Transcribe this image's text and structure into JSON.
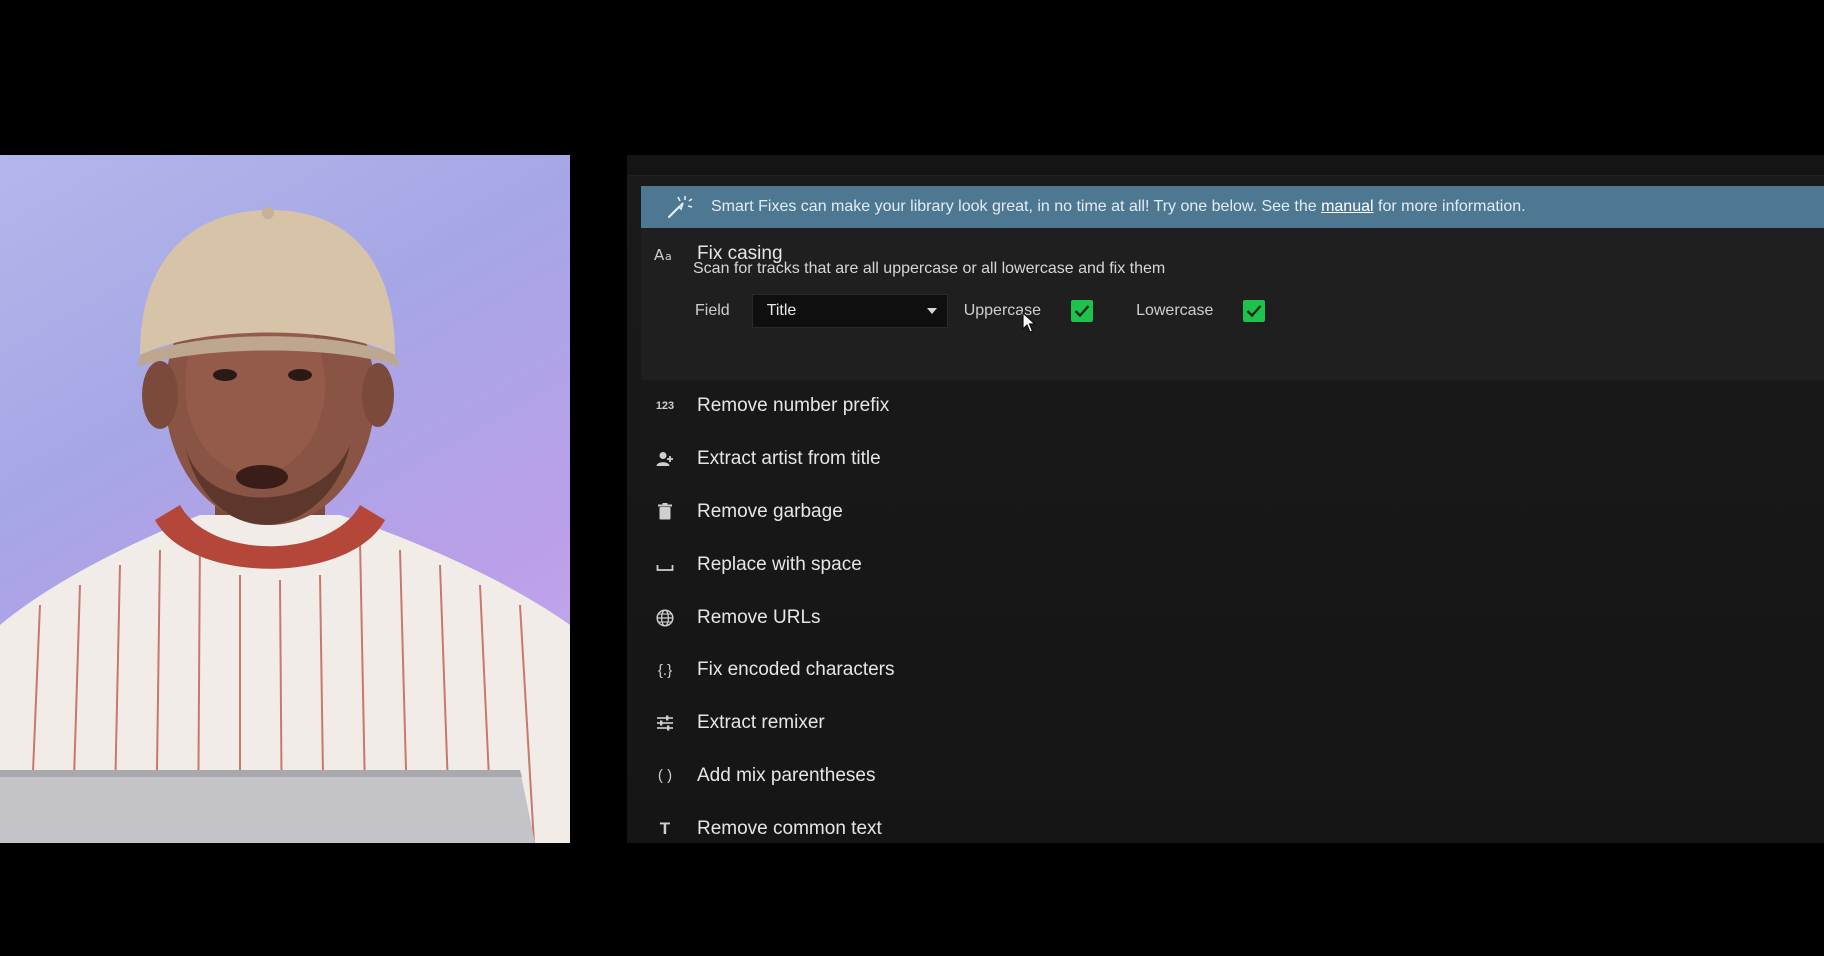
{
  "banner": {
    "text_before": "Smart Fixes can make your library look great, in no time at all! Try one below. See the ",
    "link_text": "manual",
    "text_after": " for more information."
  },
  "expanded_fix": {
    "title": "Fix casing",
    "icon": "text-case-icon",
    "description": "Scan for tracks that are all uppercase or all lowercase and fix them",
    "field_label": "Field",
    "field_value": "Title",
    "uppercase_label": "Uppercase",
    "uppercase_checked": true,
    "lowercase_label": "Lowercase",
    "lowercase_checked": true
  },
  "fixes": [
    {
      "icon": "number-123-icon",
      "glyph": "123",
      "title": "Remove number prefix"
    },
    {
      "icon": "person-add-icon",
      "glyph": "",
      "title": "Extract artist from title"
    },
    {
      "icon": "trash-icon",
      "glyph": "",
      "title": "Remove garbage"
    },
    {
      "icon": "space-bar-icon",
      "glyph": "",
      "title": "Replace with space"
    },
    {
      "icon": "globe-icon",
      "glyph": "",
      "title": "Remove URLs"
    },
    {
      "icon": "braces-icon",
      "glyph": "{.}",
      "title": "Fix encoded characters"
    },
    {
      "icon": "sliders-icon",
      "glyph": "",
      "title": "Extract remixer"
    },
    {
      "icon": "parentheses-icon",
      "glyph": "( )",
      "title": "Add mix parentheses"
    },
    {
      "icon": "text-t-icon",
      "glyph": "T",
      "title": "Remove common text"
    }
  ],
  "colors": {
    "banner_bg": "#4e7891",
    "checkbox_green": "#1fc34b",
    "panel_bg": "#1f1f1f"
  }
}
